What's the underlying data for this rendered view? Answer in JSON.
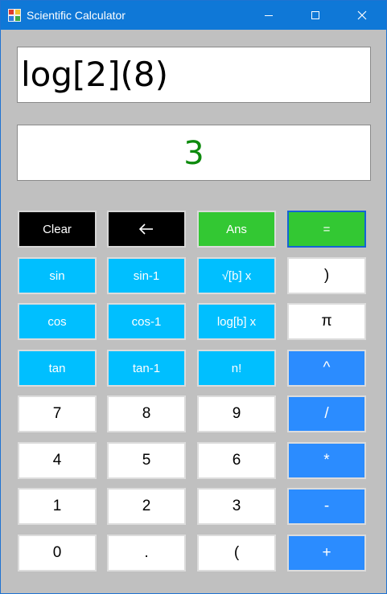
{
  "window": {
    "title": "Scientific Calculator"
  },
  "display": {
    "expression": "log[2](8)",
    "result": "3"
  },
  "buttons": {
    "clear": "Clear",
    "ans": "Ans",
    "equals": "=",
    "sin": "sin",
    "sin_inv": "sin-1",
    "root": "√[b] x",
    "close_paren": ")",
    "cos": "cos",
    "cos_inv": "cos-1",
    "log": "log[b] x",
    "pi": "π",
    "tan": "tan",
    "tan_inv": "tan-1",
    "factorial": "n!",
    "power": "^",
    "seven": "7",
    "eight": "8",
    "nine": "9",
    "divide": "/",
    "four": "4",
    "five": "5",
    "six": "6",
    "multiply": "*",
    "one": "1",
    "two": "2",
    "three": "3",
    "minus": "-",
    "zero": "0",
    "decimal": ".",
    "open_paren": "(",
    "plus": "+"
  },
  "colors": {
    "titlebar": "#0f78d7",
    "background": "#c0c0c0",
    "function_keys": "#00bfff",
    "operator_keys": "#2b8cff",
    "action_keys": "#33c833",
    "result_text": "#0d8a0d"
  },
  "icons": {
    "app": "calculator-app-icon",
    "backspace": "backspace-arrow-icon",
    "minimize": "minimize-icon",
    "maximize": "maximize-icon",
    "close": "close-icon"
  }
}
